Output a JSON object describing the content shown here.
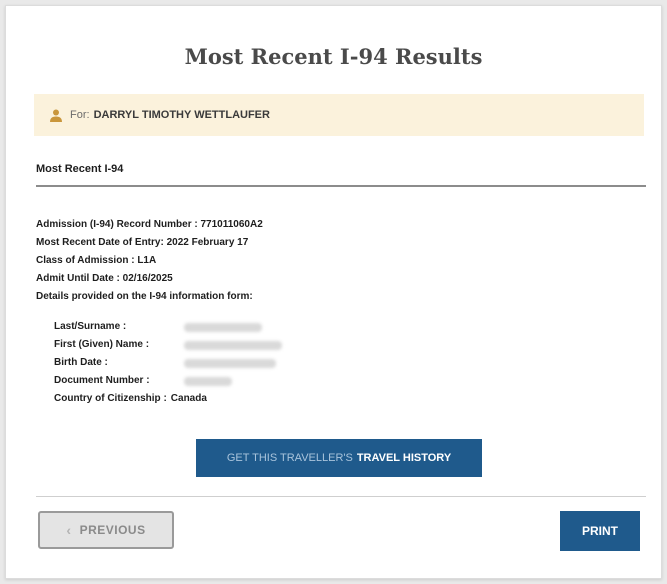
{
  "header": {
    "title": "Most Recent I-94 Results"
  },
  "alert": {
    "prefix": "For:",
    "name": "DARRYL TIMOTHY WETTLAUFER",
    "icon": "user-icon"
  },
  "section": {
    "title": "Most Recent I-94"
  },
  "record": {
    "lines": [
      "Admission (I-94) Record Number : 771011060A2",
      "Most Recent Date of Entry: 2022 February 17",
      "Class of Admission : L1A",
      "Admit Until Date : 02/16/2025",
      "Details provided on the I-94 information form:"
    ]
  },
  "info_form": {
    "rows": [
      {
        "label": "Last/Surname :",
        "value": "",
        "redacted": true
      },
      {
        "label": "First (Given) Name :",
        "value": "",
        "redacted": true
      },
      {
        "label": "Birth Date :",
        "value": "",
        "redacted": true
      },
      {
        "label": "Document Number :",
        "value": "",
        "redacted": true
      },
      {
        "label": "Country of Citizenship :",
        "value": "Canada",
        "redacted": false
      }
    ]
  },
  "buttons": {
    "travel_history_light": "GET THIS TRAVELLER'S",
    "travel_history_strong": "TRAVEL HISTORY",
    "previous": "PREVIOUS",
    "print": "PRINT"
  },
  "colors": {
    "accent": "#1f5a8c",
    "alert_bg": "#fbf2dc",
    "alert_icon": "#c9963b"
  }
}
